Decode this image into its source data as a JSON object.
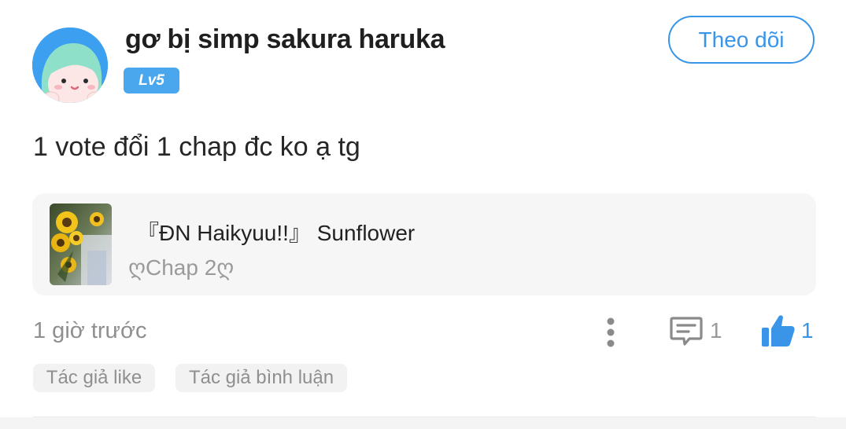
{
  "comment": {
    "author": {
      "name": "gơ bị simp sakura haruka",
      "level": "Lv5",
      "avatar_icon": "cartoon-avatar-icon"
    },
    "follow_label": "Theo dõi",
    "text": "1 vote đổi 1 chap đc ko ạ tg",
    "story": {
      "title": "『ĐN Haikyuu!!』 Sunflower",
      "chapter": "ღChap 2ღ",
      "cover_icon": "sunflower-cover-image"
    },
    "timestamp": "1 giờ trước",
    "reply_count": "1",
    "like_count": "1",
    "tags": [
      "Tác giả like",
      "Tác giả bình luận"
    ]
  },
  "colors": {
    "accent": "#3a95e8",
    "level_badge": "#4aa7ee",
    "avatar_bg": "#3d9ff0",
    "card_bg": "#f6f6f6",
    "muted_text": "#8f8f8f"
  }
}
